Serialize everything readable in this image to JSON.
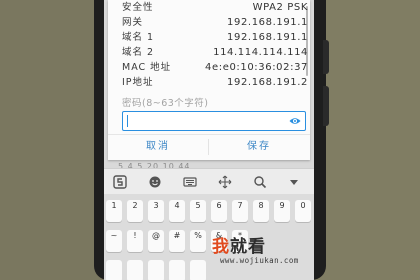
{
  "wifi_details": {
    "rows": [
      {
        "key": "安全性",
        "value": "WPA2 PSK"
      },
      {
        "key": "网关",
        "value": "192.168.191.1"
      },
      {
        "key": "域名 1",
        "value": "192.168.191.1"
      },
      {
        "key": "域名 2",
        "value": "114.114.114.114"
      },
      {
        "key": "MAC 地址",
        "value": "4e:e0:10:36:02:37"
      },
      {
        "key": "IP地址",
        "value": "192.168.191.2"
      }
    ]
  },
  "password": {
    "label": "密码(8~63个字符)",
    "value": ""
  },
  "dialog_buttons": {
    "cancel": "取消",
    "save": "保存"
  },
  "background_text": "5.4.5  20.10.44",
  "keyboard": {
    "toolbar_icons": [
      "sogou-logo-icon",
      "emoji-icon",
      "keyboard-icon",
      "cursor-move-icon",
      "search-icon",
      "collapse-icon"
    ],
    "keys": [
      {
        "top": "1",
        "bottom": ""
      },
      {
        "top": "2",
        "bottom": ""
      },
      {
        "top": "3",
        "bottom": ""
      },
      {
        "top": "4",
        "bottom": ""
      },
      {
        "top": "5",
        "bottom": ""
      },
      {
        "top": "6",
        "bottom": ""
      },
      {
        "top": "7",
        "bottom": ""
      },
      {
        "top": "8",
        "bottom": ""
      },
      {
        "top": "9",
        "bottom": ""
      },
      {
        "top": "0",
        "bottom": ""
      },
      {
        "top": "~",
        "bottom": ""
      },
      {
        "top": "!",
        "bottom": ""
      },
      {
        "top": "@",
        "bottom": ""
      },
      {
        "top": "#",
        "bottom": ""
      },
      {
        "top": "%",
        "bottom": ""
      },
      {
        "top": "&",
        "bottom": ""
      },
      {
        "top": "*",
        "bottom": ""
      }
    ]
  },
  "watermark": {
    "brand_part1": "我",
    "brand_part2": "就看",
    "url": "www.wojiukan.com"
  },
  "colors": {
    "accent": "#2a8fe0",
    "button_text": "#3d87c6",
    "watermark_red": "#e04a1e"
  }
}
